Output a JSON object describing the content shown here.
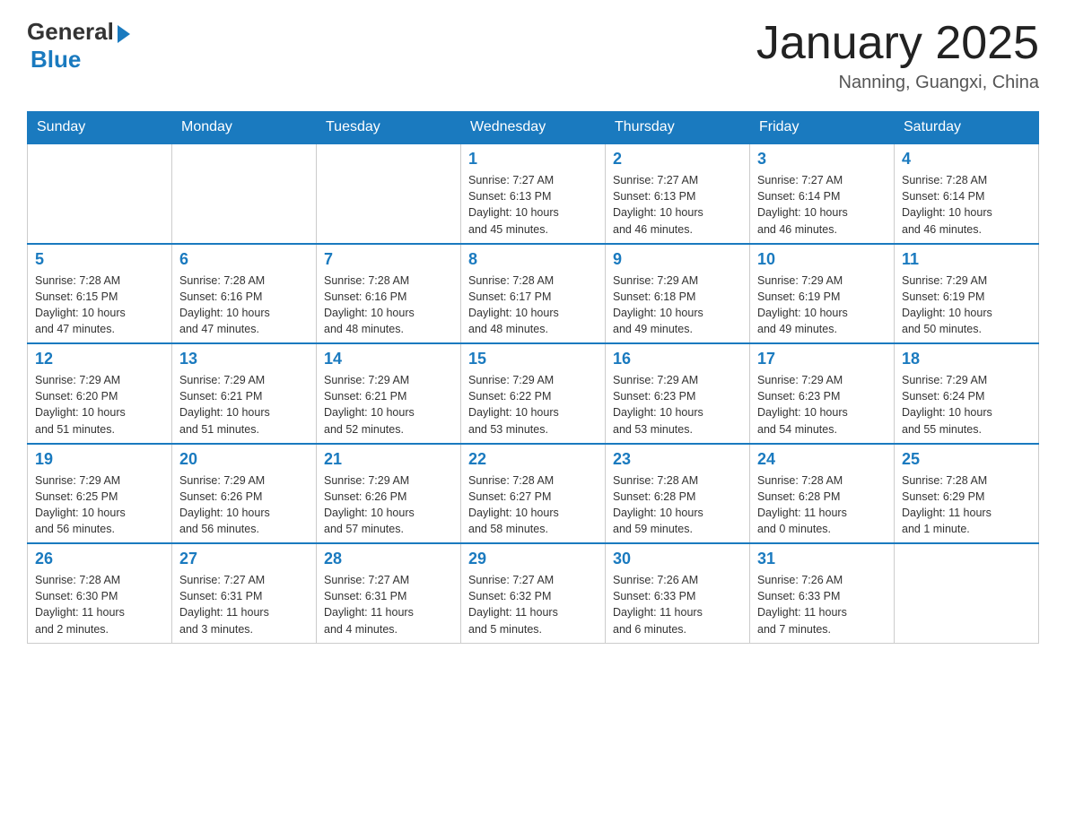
{
  "header": {
    "logo_general": "General",
    "logo_blue": "Blue",
    "month_title": "January 2025",
    "location": "Nanning, Guangxi, China"
  },
  "calendar": {
    "days_of_week": [
      "Sunday",
      "Monday",
      "Tuesday",
      "Wednesday",
      "Thursday",
      "Friday",
      "Saturday"
    ],
    "weeks": [
      [
        {
          "day": "",
          "info": ""
        },
        {
          "day": "",
          "info": ""
        },
        {
          "day": "",
          "info": ""
        },
        {
          "day": "1",
          "info": "Sunrise: 7:27 AM\nSunset: 6:13 PM\nDaylight: 10 hours\nand 45 minutes."
        },
        {
          "day": "2",
          "info": "Sunrise: 7:27 AM\nSunset: 6:13 PM\nDaylight: 10 hours\nand 46 minutes."
        },
        {
          "day": "3",
          "info": "Sunrise: 7:27 AM\nSunset: 6:14 PM\nDaylight: 10 hours\nand 46 minutes."
        },
        {
          "day": "4",
          "info": "Sunrise: 7:28 AM\nSunset: 6:14 PM\nDaylight: 10 hours\nand 46 minutes."
        }
      ],
      [
        {
          "day": "5",
          "info": "Sunrise: 7:28 AM\nSunset: 6:15 PM\nDaylight: 10 hours\nand 47 minutes."
        },
        {
          "day": "6",
          "info": "Sunrise: 7:28 AM\nSunset: 6:16 PM\nDaylight: 10 hours\nand 47 minutes."
        },
        {
          "day": "7",
          "info": "Sunrise: 7:28 AM\nSunset: 6:16 PM\nDaylight: 10 hours\nand 48 minutes."
        },
        {
          "day": "8",
          "info": "Sunrise: 7:28 AM\nSunset: 6:17 PM\nDaylight: 10 hours\nand 48 minutes."
        },
        {
          "day": "9",
          "info": "Sunrise: 7:29 AM\nSunset: 6:18 PM\nDaylight: 10 hours\nand 49 minutes."
        },
        {
          "day": "10",
          "info": "Sunrise: 7:29 AM\nSunset: 6:19 PM\nDaylight: 10 hours\nand 49 minutes."
        },
        {
          "day": "11",
          "info": "Sunrise: 7:29 AM\nSunset: 6:19 PM\nDaylight: 10 hours\nand 50 minutes."
        }
      ],
      [
        {
          "day": "12",
          "info": "Sunrise: 7:29 AM\nSunset: 6:20 PM\nDaylight: 10 hours\nand 51 minutes."
        },
        {
          "day": "13",
          "info": "Sunrise: 7:29 AM\nSunset: 6:21 PM\nDaylight: 10 hours\nand 51 minutes."
        },
        {
          "day": "14",
          "info": "Sunrise: 7:29 AM\nSunset: 6:21 PM\nDaylight: 10 hours\nand 52 minutes."
        },
        {
          "day": "15",
          "info": "Sunrise: 7:29 AM\nSunset: 6:22 PM\nDaylight: 10 hours\nand 53 minutes."
        },
        {
          "day": "16",
          "info": "Sunrise: 7:29 AM\nSunset: 6:23 PM\nDaylight: 10 hours\nand 53 minutes."
        },
        {
          "day": "17",
          "info": "Sunrise: 7:29 AM\nSunset: 6:23 PM\nDaylight: 10 hours\nand 54 minutes."
        },
        {
          "day": "18",
          "info": "Sunrise: 7:29 AM\nSunset: 6:24 PM\nDaylight: 10 hours\nand 55 minutes."
        }
      ],
      [
        {
          "day": "19",
          "info": "Sunrise: 7:29 AM\nSunset: 6:25 PM\nDaylight: 10 hours\nand 56 minutes."
        },
        {
          "day": "20",
          "info": "Sunrise: 7:29 AM\nSunset: 6:26 PM\nDaylight: 10 hours\nand 56 minutes."
        },
        {
          "day": "21",
          "info": "Sunrise: 7:29 AM\nSunset: 6:26 PM\nDaylight: 10 hours\nand 57 minutes."
        },
        {
          "day": "22",
          "info": "Sunrise: 7:28 AM\nSunset: 6:27 PM\nDaylight: 10 hours\nand 58 minutes."
        },
        {
          "day": "23",
          "info": "Sunrise: 7:28 AM\nSunset: 6:28 PM\nDaylight: 10 hours\nand 59 minutes."
        },
        {
          "day": "24",
          "info": "Sunrise: 7:28 AM\nSunset: 6:28 PM\nDaylight: 11 hours\nand 0 minutes."
        },
        {
          "day": "25",
          "info": "Sunrise: 7:28 AM\nSunset: 6:29 PM\nDaylight: 11 hours\nand 1 minute."
        }
      ],
      [
        {
          "day": "26",
          "info": "Sunrise: 7:28 AM\nSunset: 6:30 PM\nDaylight: 11 hours\nand 2 minutes."
        },
        {
          "day": "27",
          "info": "Sunrise: 7:27 AM\nSunset: 6:31 PM\nDaylight: 11 hours\nand 3 minutes."
        },
        {
          "day": "28",
          "info": "Sunrise: 7:27 AM\nSunset: 6:31 PM\nDaylight: 11 hours\nand 4 minutes."
        },
        {
          "day": "29",
          "info": "Sunrise: 7:27 AM\nSunset: 6:32 PM\nDaylight: 11 hours\nand 5 minutes."
        },
        {
          "day": "30",
          "info": "Sunrise: 7:26 AM\nSunset: 6:33 PM\nDaylight: 11 hours\nand 6 minutes."
        },
        {
          "day": "31",
          "info": "Sunrise: 7:26 AM\nSunset: 6:33 PM\nDaylight: 11 hours\nand 7 minutes."
        },
        {
          "day": "",
          "info": ""
        }
      ]
    ]
  }
}
